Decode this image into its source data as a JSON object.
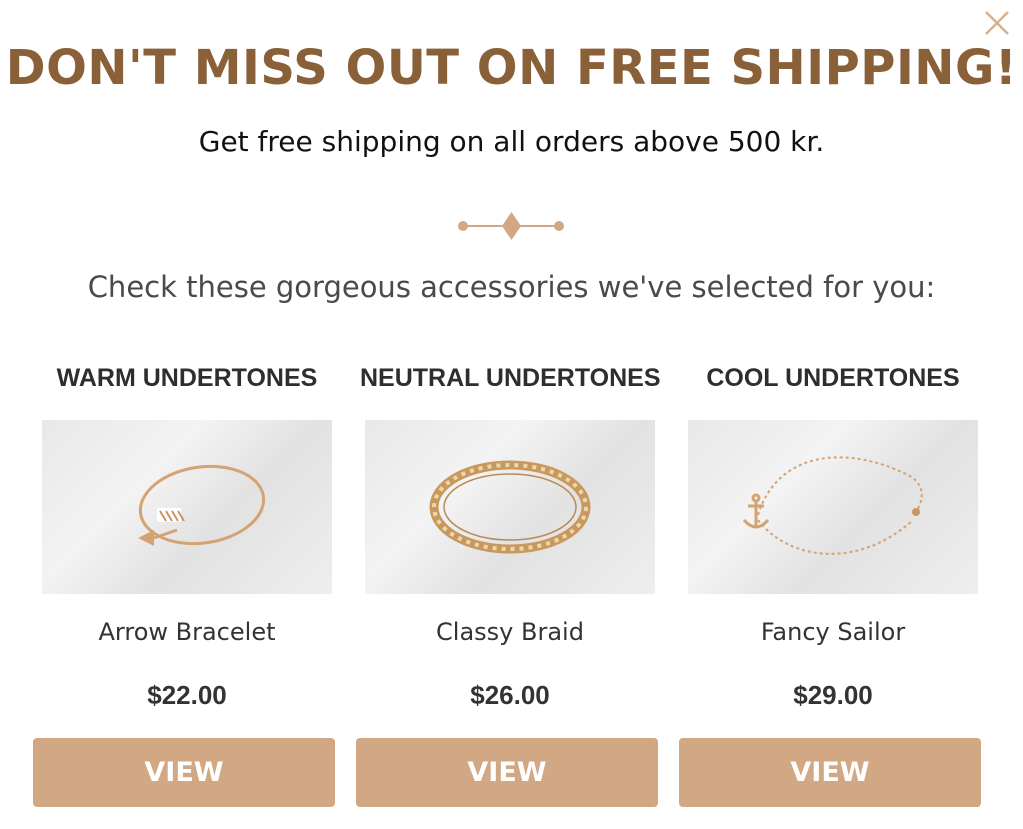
{
  "popup": {
    "headline": "DON'T MISS OUT ON FREE SHIPPING!",
    "subheadline": "Get free shipping on all orders above 500 kr.",
    "intro": "Check these gorgeous accessories we've selected for you:",
    "accent_color": "#8a6039",
    "button_color": "#d1a883",
    "close_icon": "close-icon",
    "divider_icon": "diamond-divider-icon"
  },
  "products": [
    {
      "category": "WARM UNDERTONES",
      "name": "Arrow Bracelet",
      "price": "$22.00",
      "button": "VIEW"
    },
    {
      "category": "NEUTRAL UNDERTONES",
      "name": "Classy Braid",
      "price": "$26.00",
      "button": "VIEW"
    },
    {
      "category": "COOL UNDERTONES",
      "name": "Fancy Sailor",
      "price": "$29.00",
      "button": "VIEW"
    }
  ]
}
